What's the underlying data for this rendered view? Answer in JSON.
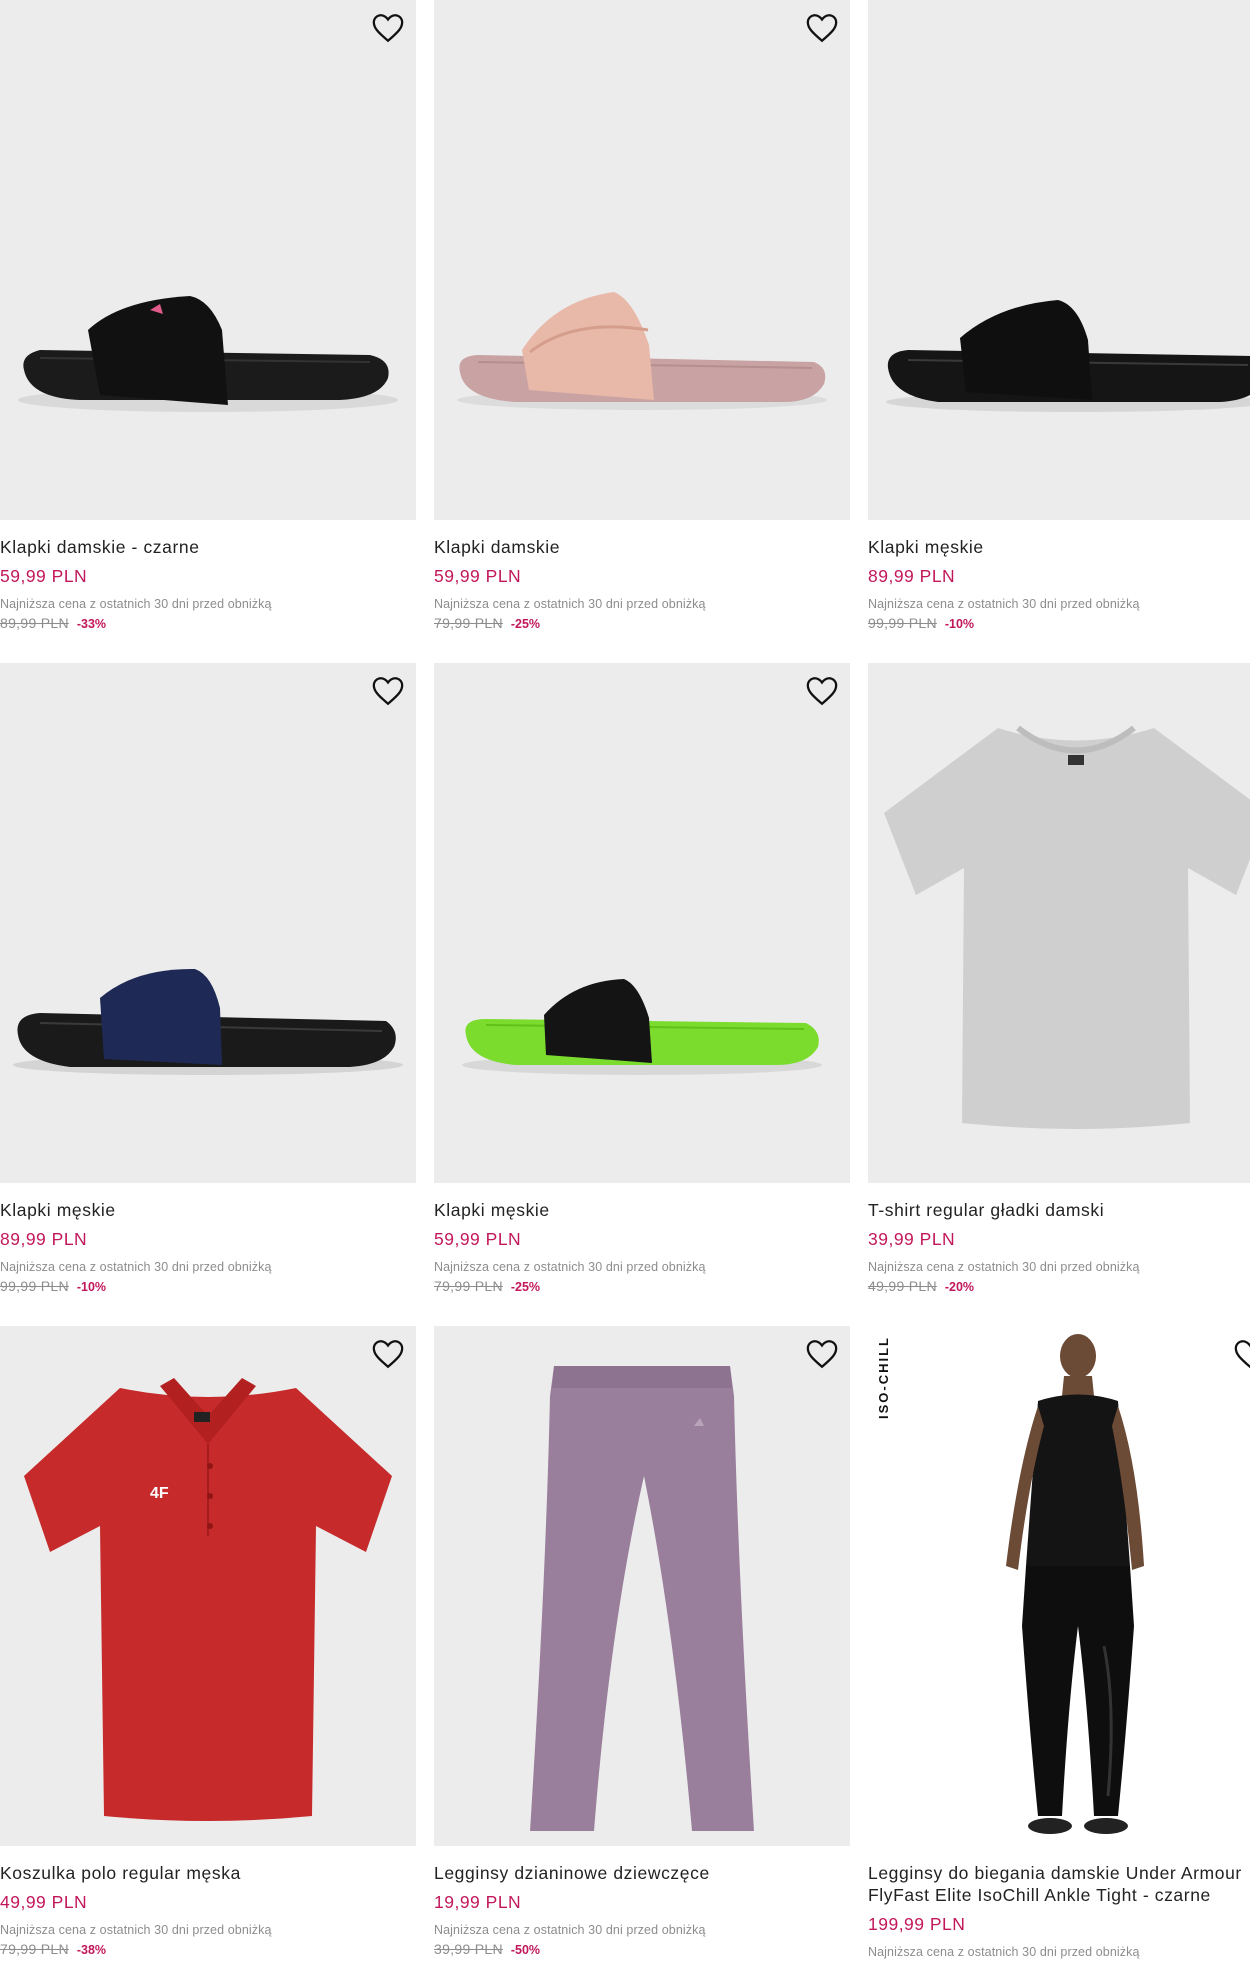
{
  "common": {
    "lowest_note": "Najniższa cena z ostatnich 30 dni przed obniżką"
  },
  "products": [
    {
      "name": "Klapki damskie - czarne",
      "price": "59,99 PLN",
      "old_price": "89,99 PLN",
      "discount": "-33%",
      "image": "black-slide-pink-logo"
    },
    {
      "name": "Klapki damskie",
      "price": "59,99 PLN",
      "old_price": "79,99 PLN",
      "discount": "-25%",
      "image": "pink-velcro-slide"
    },
    {
      "name": "Klapki męskie",
      "price": "89,99 PLN",
      "old_price": "99,99 PLN",
      "discount": "-10%",
      "image": "black-slide"
    },
    {
      "name": "Klapki męskie",
      "price": "89,99 PLN",
      "old_price": "99,99 PLN",
      "discount": "-10%",
      "image": "navy-black-slide"
    },
    {
      "name": "Klapki męskie",
      "price": "59,99 PLN",
      "old_price": "79,99 PLN",
      "discount": "-25%",
      "image": "green-black-slide"
    },
    {
      "name": "T-shirt regular gładki damski",
      "price": "39,99 PLN",
      "old_price": "49,99 PLN",
      "discount": "-20%",
      "image": "grey-tshirt"
    },
    {
      "name": "Koszulka polo regular męska",
      "price": "49,99 PLN",
      "old_price": "79,99 PLN",
      "discount": "-38%",
      "image": "red-polo",
      "logo_text": "4F"
    },
    {
      "name": "Legginsy dzianinowe dziewczęce",
      "price": "19,99 PLN",
      "old_price": "39,99 PLN",
      "discount": "-50%",
      "image": "lilac-leggings"
    },
    {
      "name": "Legginsy do biegania damskie Under Armour FlyFast Elite IsoChill Ankle Tight - czarne",
      "price": "199,99 PLN",
      "image": "woman-black-leggings",
      "badge": "ISO-CHILL"
    }
  ]
}
